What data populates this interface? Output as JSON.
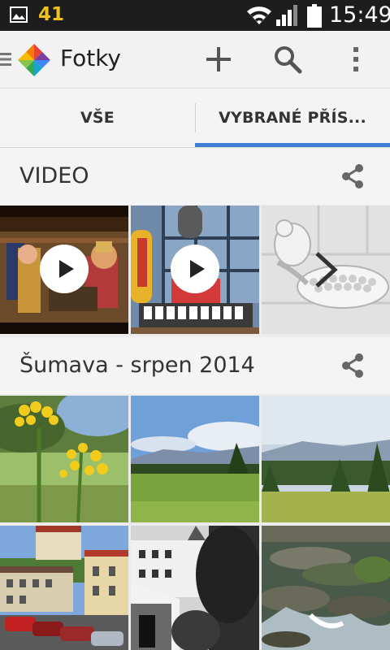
{
  "status_bar": {
    "notification_count": "41",
    "time": "15:49"
  },
  "action_bar": {
    "title": "Fotky",
    "icons": [
      "menu-icon",
      "google-photos-logo",
      "add-icon",
      "search-icon",
      "overflow-menu-icon"
    ]
  },
  "tabs": [
    {
      "label": "VŠE",
      "selected": false
    },
    {
      "label": "VYBRANÉ PŘÍS...",
      "selected": true
    }
  ],
  "colors": {
    "accent": "#3d7fd6",
    "status_bar": "#1d1d1d",
    "notification_count": "#f0c020"
  },
  "sections": [
    {
      "title": "VIDEO",
      "items": [
        {
          "kind": "video",
          "subject": "cartoon-characters-at-table"
        },
        {
          "kind": "video",
          "subject": "cartoon-character-at-keyboard"
        },
        {
          "kind": "more",
          "subject": "cartoon-mouse-with-bowl"
        }
      ]
    },
    {
      "title": "Šumava - srpen 2014",
      "items": [
        {
          "kind": "photo",
          "subject": "yellow-wildflowers"
        },
        {
          "kind": "photo",
          "subject": "meadow-landscape"
        },
        {
          "kind": "photo",
          "subject": "forest-landscape"
        },
        {
          "kind": "photo",
          "subject": "castle-town"
        },
        {
          "kind": "photo",
          "subject": "black-white-castle"
        },
        {
          "kind": "photo",
          "subject": "mountain-stream"
        }
      ]
    }
  ]
}
